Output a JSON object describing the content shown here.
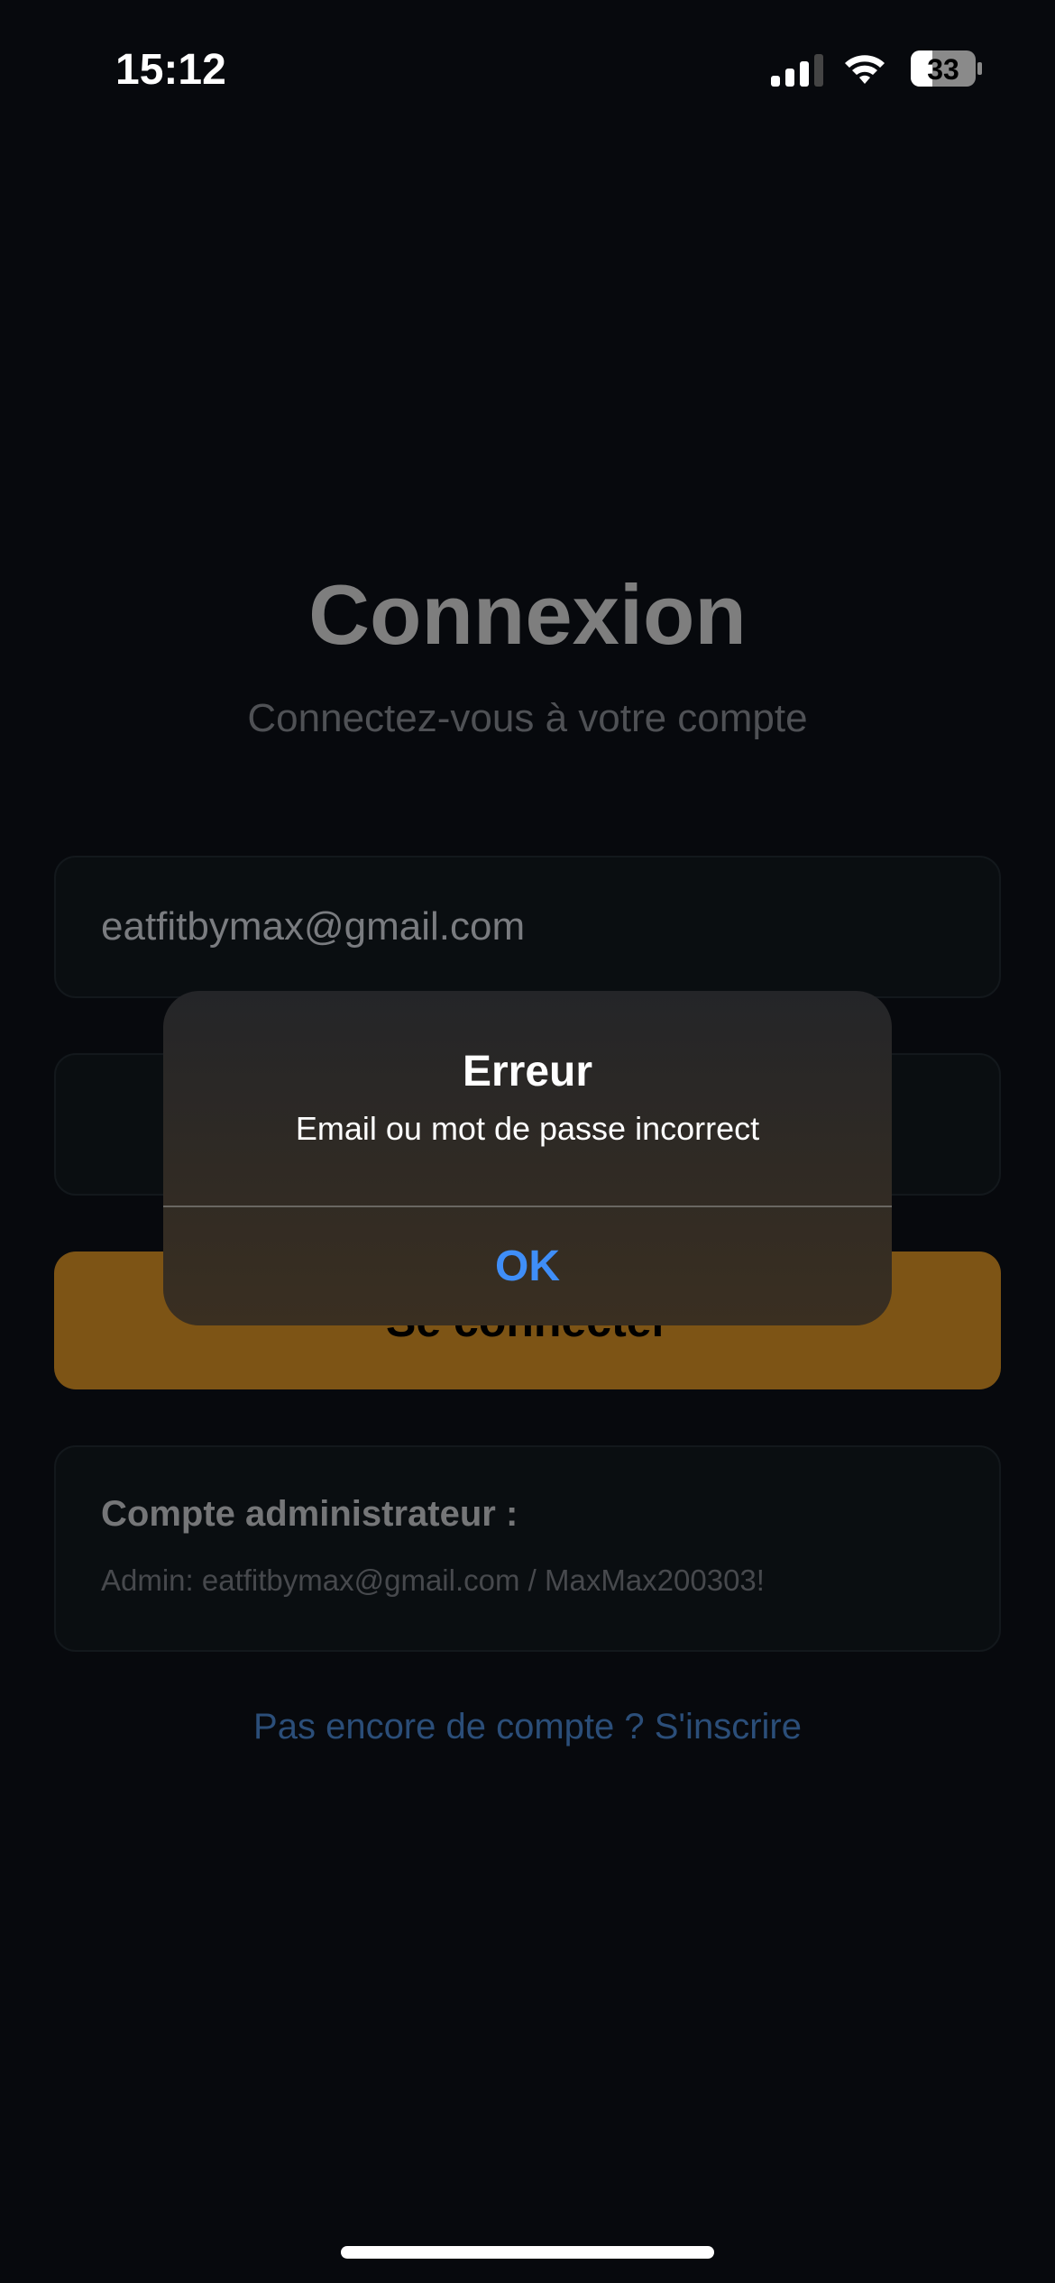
{
  "status_bar": {
    "time": "15:12",
    "battery": "33",
    "icons": [
      "signal-icon",
      "wifi-icon",
      "battery-icon"
    ]
  },
  "login": {
    "title": "Connexion",
    "subtitle": "Connectez-vous à votre compte",
    "email_value": "eatfitbymax@gmail.com",
    "password_value": "",
    "submit_label": "Se connecter",
    "admin_title": "Compte administrateur :",
    "admin_credentials": "Admin: eatfitbymax@gmail.com / MaxMax200303!",
    "signup_link": "Pas encore de compte ? S'inscrire"
  },
  "alert": {
    "title": "Erreur",
    "message": "Email ou mot de passe incorrect",
    "ok_label": "OK"
  },
  "colors": {
    "background": "#07090d",
    "accent": "#7d5415",
    "link": "#2b4e79",
    "ok": "#3f8ef8"
  }
}
